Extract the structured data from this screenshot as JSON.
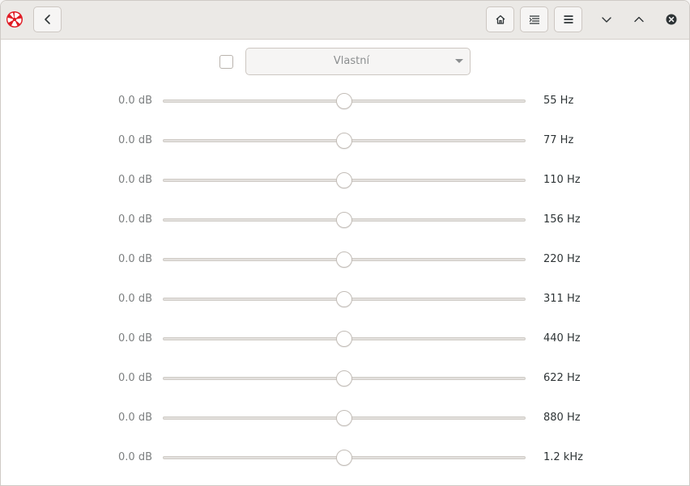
{
  "headerbar": {
    "icons": {
      "app": "app-logo-icon",
      "back": "go-back-icon",
      "home": "home-icon",
      "queue": "queue-list-icon",
      "menu": "hamburger-menu-icon",
      "minimize": "chevron-down-icon",
      "maximize": "chevron-up-icon",
      "close": "close-icon"
    },
    "accent_colors": [
      "#e01b24",
      "#ffffff"
    ]
  },
  "equalizer": {
    "preset": {
      "checked": false,
      "value": "Vlastní"
    },
    "bands": [
      {
        "gain": "0.0 dB",
        "freq": "55 Hz",
        "level": 0.5
      },
      {
        "gain": "0.0 dB",
        "freq": "77 Hz",
        "level": 0.5
      },
      {
        "gain": "0.0 dB",
        "freq": "110 Hz",
        "level": 0.5
      },
      {
        "gain": "0.0 dB",
        "freq": "156 Hz",
        "level": 0.5
      },
      {
        "gain": "0.0 dB",
        "freq": "220 Hz",
        "level": 0.5
      },
      {
        "gain": "0.0 dB",
        "freq": "311 Hz",
        "level": 0.5
      },
      {
        "gain": "0.0 dB",
        "freq": "440 Hz",
        "level": 0.5
      },
      {
        "gain": "0.0 dB",
        "freq": "622 Hz",
        "level": 0.5
      },
      {
        "gain": "0.0 dB",
        "freq": "880 Hz",
        "level": 0.5
      },
      {
        "gain": "0.0 dB",
        "freq": "1.2 kHz",
        "level": 0.5
      }
    ]
  }
}
